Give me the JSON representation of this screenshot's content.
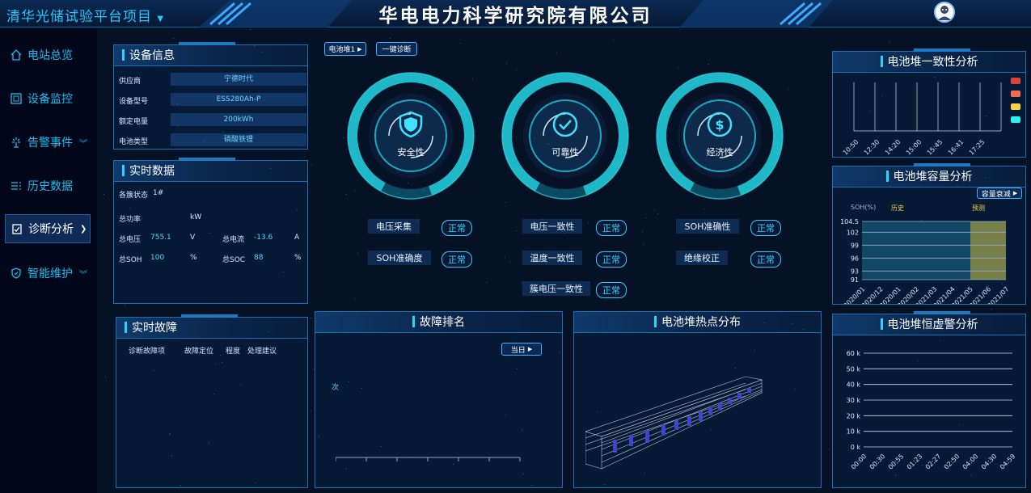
{
  "header": {
    "project_name": "清华光储试验平台项目",
    "title": "华电电力科学研究院有限公司",
    "avatar_icon": "user-avatar-icon"
  },
  "sidebar": {
    "items": [
      {
        "label": "电站总览",
        "icon": "home-icon"
      },
      {
        "label": "设备监控",
        "icon": "monitor-icon"
      },
      {
        "label": "告警事件",
        "icon": "alarm-icon"
      },
      {
        "label": "历史数据",
        "icon": "history-icon"
      },
      {
        "label": "诊断分析",
        "icon": "clipboard-icon"
      },
      {
        "label": "智能维护",
        "icon": "shield-check-icon"
      }
    ]
  },
  "equipment_info": {
    "title": "设备信息",
    "rows": [
      {
        "label": "供应商",
        "value": "宁德时代"
      },
      {
        "label": "设备型号",
        "value": "ESS280Ah-P"
      },
      {
        "label": "额定电量",
        "value": "200kWh"
      },
      {
        "label": "电池类型",
        "value": "磷酸铁锂"
      }
    ]
  },
  "realtime_data": {
    "title": "实时数据",
    "cluster_status_label": "各簇状态",
    "cluster_status_value": "1#",
    "total_power_label": "总功率",
    "total_power_unit": "kW",
    "total_voltage_label": "总电压",
    "total_voltage_value": "755.1",
    "total_voltage_unit": "V",
    "total_current_label": "总电流",
    "total_current_value": "-13.6",
    "total_current_unit": "A",
    "total_soh_label": "总SOH",
    "total_soh_value": "100",
    "total_soh_unit": "%",
    "total_soc_label": "总SOC",
    "total_soc_value": "88",
    "total_soc_unit": "%"
  },
  "diagnosis": {
    "stack_select": "电池堆1",
    "one_click": "一键诊断",
    "gauges": [
      {
        "label": "安全性",
        "icon": "shield-icon"
      },
      {
        "label": "可靠性",
        "icon": "check-circle-icon"
      },
      {
        "label": "经济性",
        "icon": "dollar-icon"
      }
    ],
    "items": [
      {
        "label": "电压采集",
        "status": "正常"
      },
      {
        "label": "电压一致性",
        "status": "正常"
      },
      {
        "label": "SOH准确性",
        "status": "正常"
      },
      {
        "label": "SOH准确度",
        "status": "正常"
      },
      {
        "label": "温度一致性",
        "status": "正常"
      },
      {
        "label": "绝缘校正",
        "status": "正常"
      },
      {
        "label": "簇电压一致性",
        "status": "正常"
      }
    ]
  },
  "realtime_faults": {
    "title": "实时故障",
    "columns": [
      "诊断故障项",
      "故障定位",
      "程度",
      "处理建议"
    ]
  },
  "fault_ranking": {
    "title": "故障排名",
    "period_button": "当日",
    "y_unit": "次"
  },
  "hotspot": {
    "title": "电池堆热点分布"
  },
  "consistency_chart": {
    "title": "电池堆一致性分析",
    "legend_colors": [
      "#d9433f",
      "#f06d4f",
      "#f5d547",
      "#2ef0f0"
    ],
    "chart_data": {
      "type": "bar",
      "categories": [
        "10:50",
        "12:30",
        "14:20",
        "15:00",
        "15:45",
        "16:41",
        "17:25"
      ],
      "series": []
    }
  },
  "capacity_chart": {
    "title": "电池堆容量分析",
    "button": "容量衰减",
    "y_unit_label": "SOH(%)",
    "history_label": "历史",
    "forecast_label": "预测",
    "chart_data": {
      "type": "area",
      "x": [
        "2020/01",
        "2020/12",
        "2020/01",
        "2020/02",
        "2021/03",
        "2021/04",
        "2021/05",
        "2021/06",
        "2021/07"
      ],
      "y_ticks": [
        91,
        93,
        96,
        99,
        102,
        104.5
      ],
      "ylim": [
        91,
        104.5
      ],
      "forecast_start_index": 6
    }
  },
  "virtual_alarm_chart": {
    "title": "电池堆恒虚警分析",
    "chart_data": {
      "type": "line",
      "y_ticks": [
        "0 k",
        "10 k",
        "20 k",
        "30 k",
        "40 k",
        "50 k",
        "60 k"
      ],
      "x": [
        "00:00",
        "00:30",
        "00:55",
        "01:23",
        "02:27",
        "02:50",
        "04:00",
        "04:30",
        "04:59"
      ],
      "ylim": [
        0,
        60000
      ],
      "series": []
    }
  }
}
